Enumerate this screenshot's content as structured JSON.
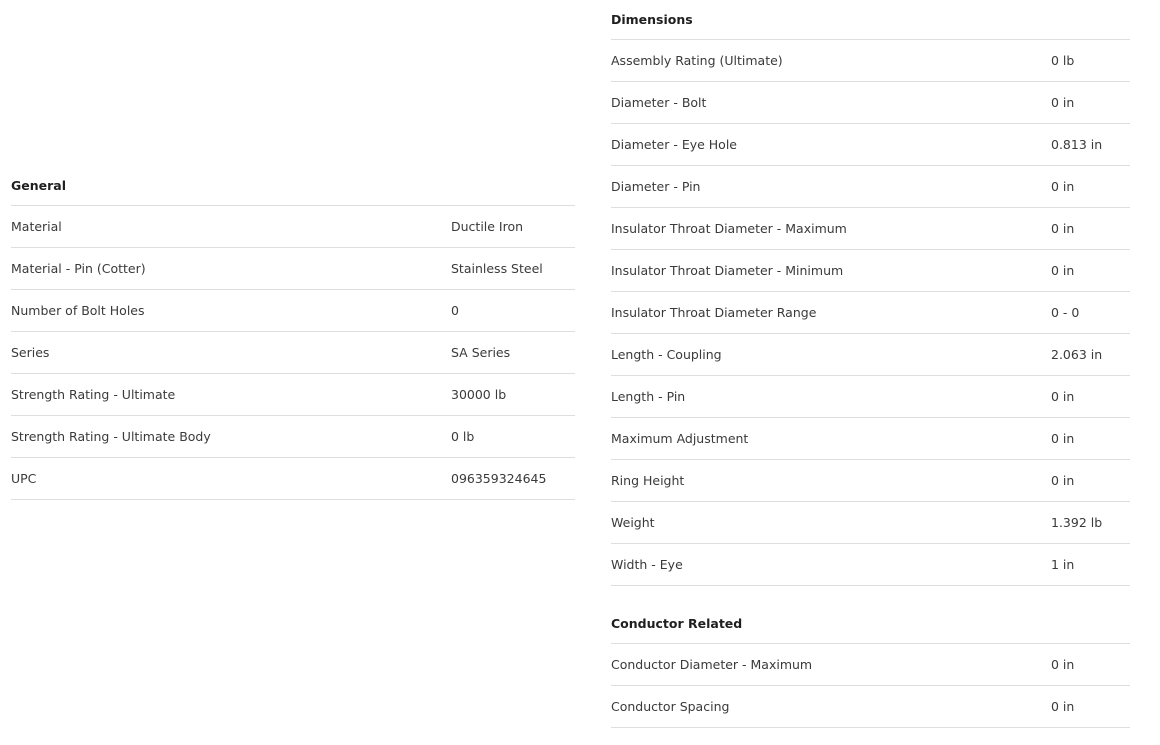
{
  "general": {
    "title": "General",
    "rows": [
      {
        "label": "Material",
        "value": "Ductile Iron"
      },
      {
        "label": "Material - Pin (Cotter)",
        "value": "Stainless Steel"
      },
      {
        "label": "Number of Bolt Holes",
        "value": "0"
      },
      {
        "label": "Series",
        "value": "SA Series"
      },
      {
        "label": "Strength Rating - Ultimate",
        "value": "30000 lb"
      },
      {
        "label": "Strength Rating - Ultimate Body",
        "value": "0 lb"
      },
      {
        "label": "UPC",
        "value": "096359324645"
      }
    ]
  },
  "dimensions": {
    "title": "Dimensions",
    "rows": [
      {
        "label": "Assembly Rating (Ultimate)",
        "value": "0 lb"
      },
      {
        "label": "Diameter - Bolt",
        "value": "0 in"
      },
      {
        "label": "Diameter - Eye Hole",
        "value": "0.813 in"
      },
      {
        "label": "Diameter - Pin",
        "value": "0 in"
      },
      {
        "label": "Insulator Throat Diameter - Maximum",
        "value": "0 in"
      },
      {
        "label": "Insulator Throat Diameter - Minimum",
        "value": "0 in"
      },
      {
        "label": "Insulator Throat Diameter Range",
        "value": "0 - 0"
      },
      {
        "label": "Length - Coupling",
        "value": "2.063 in"
      },
      {
        "label": "Length - Pin",
        "value": "0 in"
      },
      {
        "label": "Maximum Adjustment",
        "value": "0 in"
      },
      {
        "label": "Ring Height",
        "value": "0 in"
      },
      {
        "label": "Weight",
        "value": "1.392 lb"
      },
      {
        "label": "Width - Eye",
        "value": "1 in"
      }
    ]
  },
  "conductor": {
    "title": "Conductor Related",
    "rows": [
      {
        "label": "Conductor Diameter - Maximum",
        "value": "0 in"
      },
      {
        "label": "Conductor Spacing",
        "value": "0 in"
      }
    ]
  }
}
